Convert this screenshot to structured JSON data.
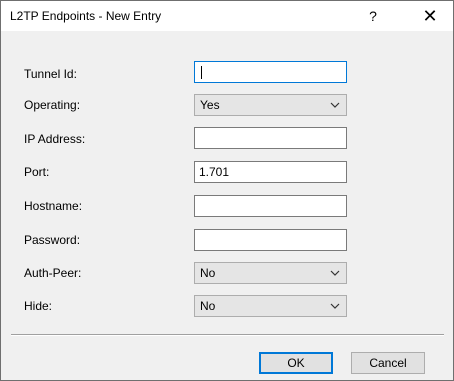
{
  "window": {
    "title": "L2TP Endpoints - New Entry",
    "help_glyph": "?",
    "close_glyph": "✕"
  },
  "form": {
    "tunnel_id": {
      "label": "Tunnel Id:",
      "value": ""
    },
    "operating": {
      "label": "Operating:",
      "value": "Yes"
    },
    "ip_address": {
      "label": "IP Address:",
      "value": ""
    },
    "port": {
      "label": "Port:",
      "value": "1.701"
    },
    "hostname": {
      "label": "Hostname:",
      "value": ""
    },
    "password": {
      "label": "Password:",
      "value": ""
    },
    "auth_peer": {
      "label": "Auth-Peer:",
      "value": "No"
    },
    "hide": {
      "label": "Hide:",
      "value": "No"
    }
  },
  "buttons": {
    "ok": "OK",
    "cancel": "Cancel"
  },
  "icons": {
    "help": "help-icon",
    "close": "close-icon",
    "dropdown": "chevron-down-icon"
  },
  "colors": {
    "focus_accent": "#0078d7",
    "dialog_bg": "#f0f0f0"
  }
}
